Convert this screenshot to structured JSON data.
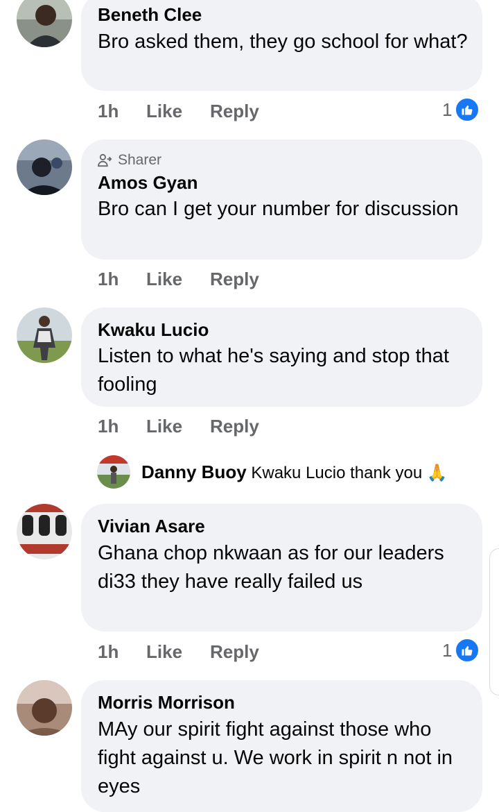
{
  "comments": [
    {
      "name": "Beneth Clee",
      "text": "Bro asked them, they go school for what?",
      "time": "1h",
      "like": "Like",
      "reply": "Reply",
      "reaction_count": "1"
    },
    {
      "badge": "Sharer",
      "name": "Amos Gyan",
      "text": "Bro can I get your number for discussion",
      "time": "1h",
      "like": "Like",
      "reply": "Reply"
    },
    {
      "name": "Kwaku Lucio",
      "text": "Listen to what he's saying and stop that fooling",
      "time": "1h",
      "like": "Like",
      "reply": "Reply"
    },
    {
      "name": "Vivian Asare",
      "text": "Ghana chop nkwaan as for our leaders di33 they have really failed us",
      "time": "1h",
      "like": "Like",
      "reply": "Reply",
      "reaction_count": "1"
    },
    {
      "name": "Morris Morrison",
      "text": "MAy our spirit fight against those who fight against u. We work in spirit n not in eyes"
    }
  ],
  "reply": {
    "name": "Danny Buoy",
    "text": "Kwaku Lucio thank you",
    "emoji": "🙏"
  },
  "icons": {
    "reaction": "like-icon",
    "sharer": "share-person-icon",
    "emoji": "folded-hands"
  },
  "colors": {
    "bubble": "#f0f2f5",
    "secondary_text": "#65676b",
    "like_blue": "#1877f2"
  }
}
